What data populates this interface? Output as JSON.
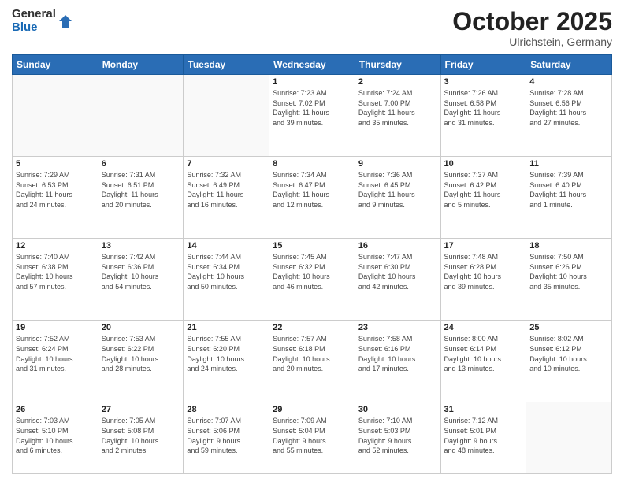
{
  "header": {
    "logo_general": "General",
    "logo_blue": "Blue",
    "month_title": "October 2025",
    "location": "Ulrichstein, Germany"
  },
  "weekdays": [
    "Sunday",
    "Monday",
    "Tuesday",
    "Wednesday",
    "Thursday",
    "Friday",
    "Saturday"
  ],
  "weeks": [
    [
      {
        "day": "",
        "info": ""
      },
      {
        "day": "",
        "info": ""
      },
      {
        "day": "",
        "info": ""
      },
      {
        "day": "1",
        "info": "Sunrise: 7:23 AM\nSunset: 7:02 PM\nDaylight: 11 hours\nand 39 minutes."
      },
      {
        "day": "2",
        "info": "Sunrise: 7:24 AM\nSunset: 7:00 PM\nDaylight: 11 hours\nand 35 minutes."
      },
      {
        "day": "3",
        "info": "Sunrise: 7:26 AM\nSunset: 6:58 PM\nDaylight: 11 hours\nand 31 minutes."
      },
      {
        "day": "4",
        "info": "Sunrise: 7:28 AM\nSunset: 6:56 PM\nDaylight: 11 hours\nand 27 minutes."
      }
    ],
    [
      {
        "day": "5",
        "info": "Sunrise: 7:29 AM\nSunset: 6:53 PM\nDaylight: 11 hours\nand 24 minutes."
      },
      {
        "day": "6",
        "info": "Sunrise: 7:31 AM\nSunset: 6:51 PM\nDaylight: 11 hours\nand 20 minutes."
      },
      {
        "day": "7",
        "info": "Sunrise: 7:32 AM\nSunset: 6:49 PM\nDaylight: 11 hours\nand 16 minutes."
      },
      {
        "day": "8",
        "info": "Sunrise: 7:34 AM\nSunset: 6:47 PM\nDaylight: 11 hours\nand 12 minutes."
      },
      {
        "day": "9",
        "info": "Sunrise: 7:36 AM\nSunset: 6:45 PM\nDaylight: 11 hours\nand 9 minutes."
      },
      {
        "day": "10",
        "info": "Sunrise: 7:37 AM\nSunset: 6:42 PM\nDaylight: 11 hours\nand 5 minutes."
      },
      {
        "day": "11",
        "info": "Sunrise: 7:39 AM\nSunset: 6:40 PM\nDaylight: 11 hours\nand 1 minute."
      }
    ],
    [
      {
        "day": "12",
        "info": "Sunrise: 7:40 AM\nSunset: 6:38 PM\nDaylight: 10 hours\nand 57 minutes."
      },
      {
        "day": "13",
        "info": "Sunrise: 7:42 AM\nSunset: 6:36 PM\nDaylight: 10 hours\nand 54 minutes."
      },
      {
        "day": "14",
        "info": "Sunrise: 7:44 AM\nSunset: 6:34 PM\nDaylight: 10 hours\nand 50 minutes."
      },
      {
        "day": "15",
        "info": "Sunrise: 7:45 AM\nSunset: 6:32 PM\nDaylight: 10 hours\nand 46 minutes."
      },
      {
        "day": "16",
        "info": "Sunrise: 7:47 AM\nSunset: 6:30 PM\nDaylight: 10 hours\nand 42 minutes."
      },
      {
        "day": "17",
        "info": "Sunrise: 7:48 AM\nSunset: 6:28 PM\nDaylight: 10 hours\nand 39 minutes."
      },
      {
        "day": "18",
        "info": "Sunrise: 7:50 AM\nSunset: 6:26 PM\nDaylight: 10 hours\nand 35 minutes."
      }
    ],
    [
      {
        "day": "19",
        "info": "Sunrise: 7:52 AM\nSunset: 6:24 PM\nDaylight: 10 hours\nand 31 minutes."
      },
      {
        "day": "20",
        "info": "Sunrise: 7:53 AM\nSunset: 6:22 PM\nDaylight: 10 hours\nand 28 minutes."
      },
      {
        "day": "21",
        "info": "Sunrise: 7:55 AM\nSunset: 6:20 PM\nDaylight: 10 hours\nand 24 minutes."
      },
      {
        "day": "22",
        "info": "Sunrise: 7:57 AM\nSunset: 6:18 PM\nDaylight: 10 hours\nand 20 minutes."
      },
      {
        "day": "23",
        "info": "Sunrise: 7:58 AM\nSunset: 6:16 PM\nDaylight: 10 hours\nand 17 minutes."
      },
      {
        "day": "24",
        "info": "Sunrise: 8:00 AM\nSunset: 6:14 PM\nDaylight: 10 hours\nand 13 minutes."
      },
      {
        "day": "25",
        "info": "Sunrise: 8:02 AM\nSunset: 6:12 PM\nDaylight: 10 hours\nand 10 minutes."
      }
    ],
    [
      {
        "day": "26",
        "info": "Sunrise: 7:03 AM\nSunset: 5:10 PM\nDaylight: 10 hours\nand 6 minutes."
      },
      {
        "day": "27",
        "info": "Sunrise: 7:05 AM\nSunset: 5:08 PM\nDaylight: 10 hours\nand 2 minutes."
      },
      {
        "day": "28",
        "info": "Sunrise: 7:07 AM\nSunset: 5:06 PM\nDaylight: 9 hours\nand 59 minutes."
      },
      {
        "day": "29",
        "info": "Sunrise: 7:09 AM\nSunset: 5:04 PM\nDaylight: 9 hours\nand 55 minutes."
      },
      {
        "day": "30",
        "info": "Sunrise: 7:10 AM\nSunset: 5:03 PM\nDaylight: 9 hours\nand 52 minutes."
      },
      {
        "day": "31",
        "info": "Sunrise: 7:12 AM\nSunset: 5:01 PM\nDaylight: 9 hours\nand 48 minutes."
      },
      {
        "day": "",
        "info": ""
      }
    ]
  ]
}
